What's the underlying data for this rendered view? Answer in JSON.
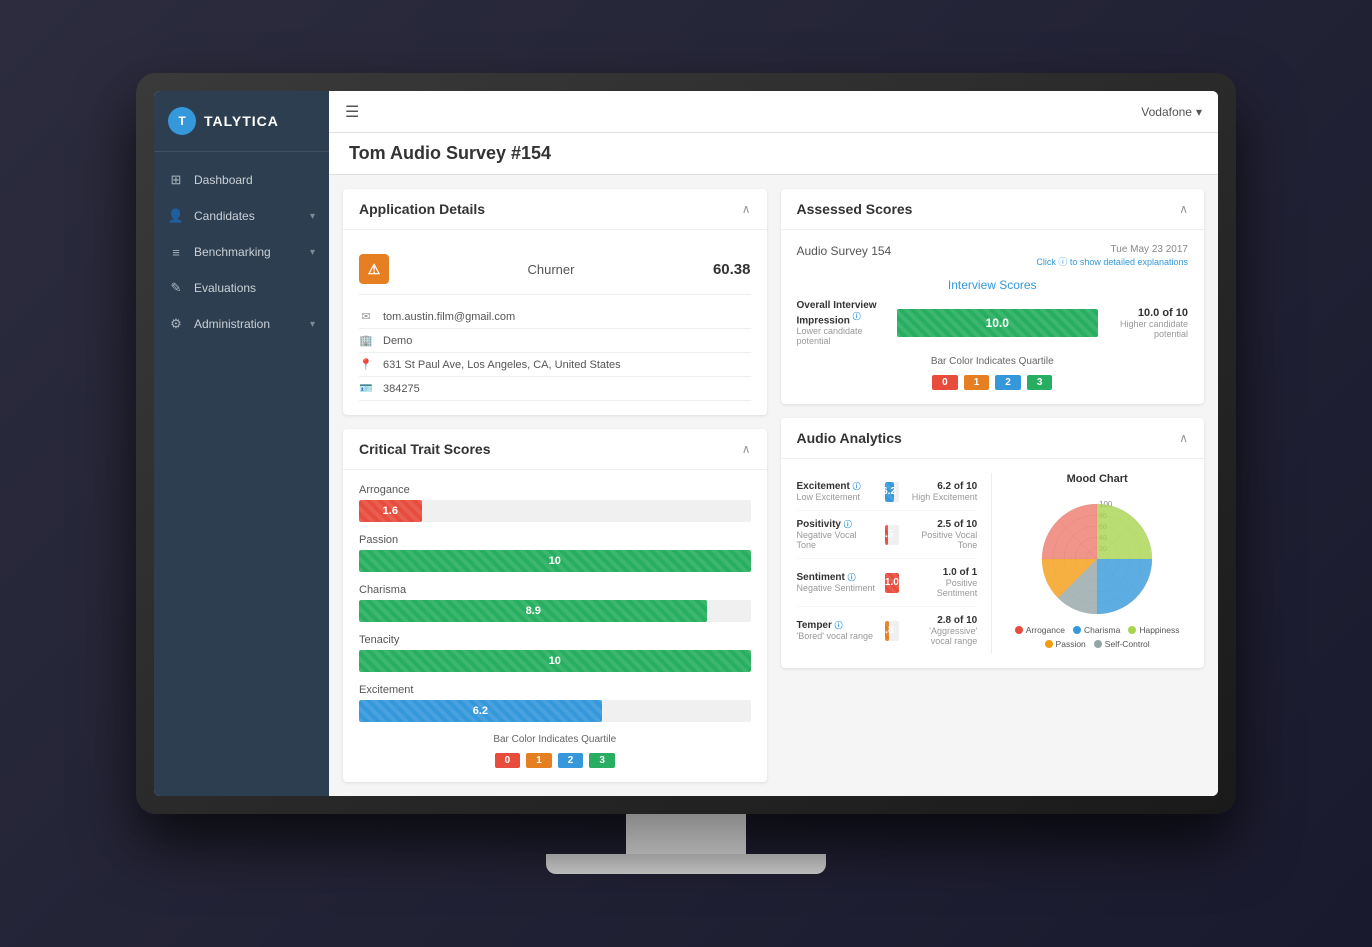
{
  "monitor": {
    "title": "Talytica"
  },
  "header": {
    "title": "Tom Audio Survey #154",
    "user": "Vodafone",
    "hamburger": "☰"
  },
  "sidebar": {
    "logo": "TALYTICA",
    "nav": [
      {
        "id": "dashboard",
        "label": "Dashboard",
        "icon": "⊞",
        "hasArrow": false
      },
      {
        "id": "candidates",
        "label": "Candidates",
        "icon": "👤",
        "hasArrow": true
      },
      {
        "id": "benchmarking",
        "label": "Benchmarking",
        "icon": "≡",
        "hasArrow": true
      },
      {
        "id": "evaluations",
        "label": "Evaluations",
        "icon": "✎",
        "hasArrow": false
      },
      {
        "id": "administration",
        "label": "Administration",
        "icon": "⚙",
        "hasArrow": true
      }
    ]
  },
  "applicationDetails": {
    "title": "Application Details",
    "label": "Churner",
    "score": "60.38",
    "email": "tom.austin.film@gmail.com",
    "company": "Demo",
    "address": "631 St Paul Ave, Los Angeles, CA, United States",
    "id": "384275",
    "warningIcon": "⚠"
  },
  "criticalTraits": {
    "title": "Critical Trait Scores",
    "traits": [
      {
        "name": "Arrogance",
        "value": 1.6,
        "percent": 16,
        "colorClass": "bar-red"
      },
      {
        "name": "Passion",
        "value": 10.0,
        "percent": 100,
        "colorClass": "bar-green"
      },
      {
        "name": "Charisma",
        "value": 8.9,
        "percent": 89,
        "colorClass": "bar-green"
      },
      {
        "name": "Tenacity",
        "value": 10.0,
        "percent": 100,
        "colorClass": "bar-green"
      },
      {
        "name": "Excitement",
        "value": 6.2,
        "percent": 62,
        "colorClass": "bar-blue"
      }
    ],
    "quartileLabel": "Bar Color Indicates Quartile",
    "quartiles": [
      {
        "label": "0",
        "colorClass": "bar-red"
      },
      {
        "label": "1",
        "colorClass": "bar-orange"
      },
      {
        "label": "2",
        "colorClass": "bar-blue"
      },
      {
        "label": "3",
        "colorClass": "bar-green"
      }
    ]
  },
  "assessedScores": {
    "title": "Assessed Scores",
    "surveyTitle": "Audio Survey 154",
    "date": "Tue May 23 2017",
    "clickInfo": "Click ⓘ to show detailed explanations",
    "interviewScoresTitle": "Interview Scores",
    "overallInterview": {
      "labelMain": "Overall Interview Impression ⓘ",
      "labelSub": "Lower candidate potential",
      "barValue": "10.0",
      "scoreMain": "10.0 of 10",
      "scoreSub": "Higher candidate potential"
    },
    "quartileLabel": "Bar Color Indicates Quartile",
    "quartiles": [
      {
        "label": "0",
        "colorClass": "bar-red"
      },
      {
        "label": "1",
        "colorClass": "bar-orange"
      },
      {
        "label": "2",
        "colorClass": "bar-blue"
      },
      {
        "label": "3",
        "colorClass": "bar-green"
      }
    ]
  },
  "audioAnalytics": {
    "title": "Audio Analytics",
    "metrics": [
      {
        "name": "Excitement",
        "sub": "Low Excitement",
        "barValue": "6.2",
        "barPercent": 62,
        "colorClass": "bar-blue",
        "scoreMain": "6.2 of 10",
        "scoreSub": "High Excitement"
      },
      {
        "name": "Positivity",
        "sub": "Negative Vocal Tone",
        "barValue": "2.5",
        "barPercent": 25,
        "colorClass": "bar-red",
        "scoreMain": "2.5 of 10",
        "scoreSub": "Positive Vocal Tone"
      },
      {
        "name": "Sentiment",
        "sub": "Negative Sentiment",
        "barValue": "1.0",
        "barPercent": 100,
        "colorClass": "bar-red",
        "scoreMain": "1.0 of 1",
        "scoreSub": "Positive Sentiment"
      },
      {
        "name": "Temper",
        "sub": "'Bored' vocal range",
        "barValue": "2.8",
        "barPercent": 28,
        "colorClass": "bar-orange",
        "scoreMain": "2.8 of 10",
        "scoreSub": "'Aggressive' vocal range"
      }
    ],
    "moodChart": {
      "title": "Mood Chart",
      "maxLabel": "100",
      "levels": [
        100,
        80,
        60,
        40,
        20
      ],
      "legend": [
        {
          "label": "Arrogance",
          "color": "#e74c3c"
        },
        {
          "label": "Charisma",
          "color": "#3498db"
        },
        {
          "label": "Happiness",
          "color": "#a8d44f"
        },
        {
          "label": "Passion",
          "color": "#f39c12"
        },
        {
          "label": "Self-Control",
          "color": "#95a5a6"
        }
      ]
    }
  }
}
